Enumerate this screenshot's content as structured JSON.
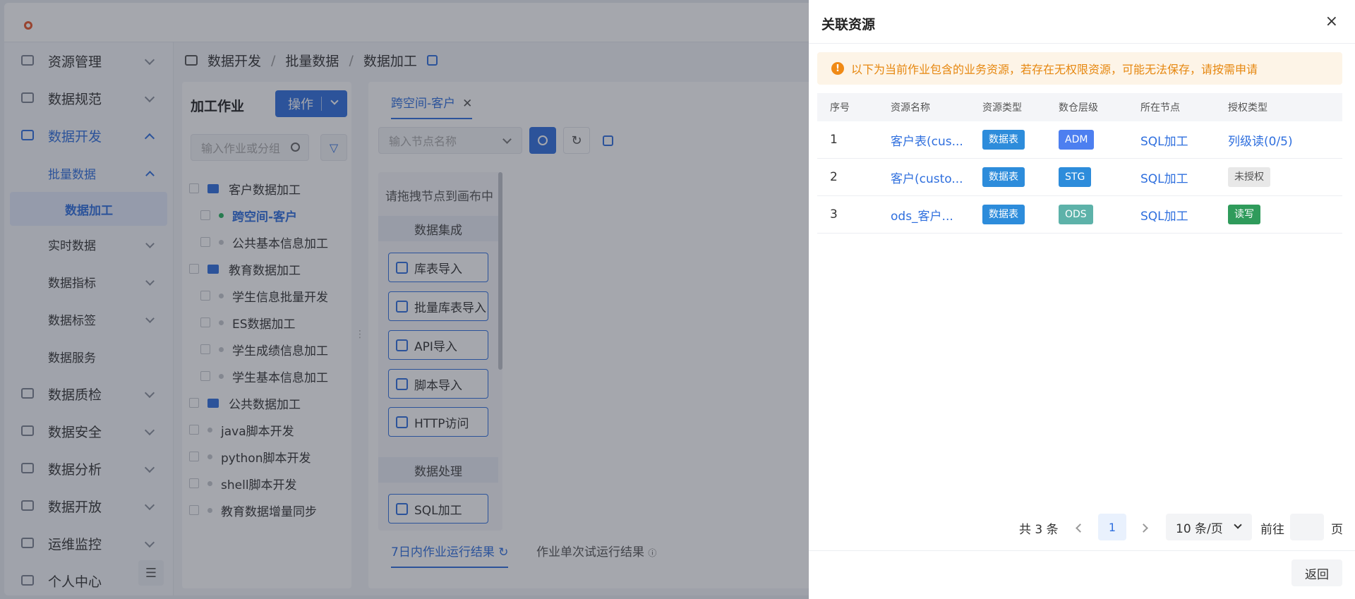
{
  "sidebar": {
    "items": [
      {
        "label": "资源管理"
      },
      {
        "label": "数据规范"
      },
      {
        "label": "数据开发"
      },
      {
        "label": "批量数据"
      },
      {
        "label": "数据加工"
      },
      {
        "label": "实时数据"
      },
      {
        "label": "数据指标"
      },
      {
        "label": "数据标签"
      },
      {
        "label": "数据服务"
      },
      {
        "label": "数据质检"
      },
      {
        "label": "数据安全"
      },
      {
        "label": "数据分析"
      },
      {
        "label": "数据开放"
      },
      {
        "label": "运维监控"
      },
      {
        "label": "个人中心"
      }
    ]
  },
  "breadcrumb": {
    "l1": "数据开发",
    "sep": "/",
    "l2": "批量数据",
    "l3": "数据加工"
  },
  "jobs": {
    "title": "加工作业",
    "op_label": "操作",
    "search_placeholder": "输入作业或分组",
    "tree": [
      "客户数据加工",
      "跨空间-客户",
      "公共基本信息加工",
      "教育数据加工",
      "学生信息批量开发",
      "ES数据加工",
      "学生成绩信息加工",
      "学生基本信息加工",
      "公共数据加工",
      "java脚本开发",
      "python脚本开发",
      "shell脚本开发",
      "教育数据增量同步"
    ]
  },
  "editor": {
    "tab": "跨空间-客户",
    "node_placeholder": "输入节点名称",
    "hint": "请拖拽节点到画布中",
    "sec1": "数据集成",
    "nodes1": [
      "库表导入",
      "批量库表导入",
      "API导入",
      "脚本导入",
      "HTTP访问"
    ],
    "sec2": "数据处理",
    "nodes2": [
      "SQL加工"
    ],
    "bottom_tab1": "7日内作业运行结果",
    "bottom_tab2": "作业单次试运行结果"
  },
  "drawer": {
    "title": "关联资源",
    "close": "×",
    "alert": "以下为当前作业包含的业务资源，若存在无权限资源，可能无法保存，请按需申请",
    "alert_icon": "!",
    "columns": [
      "序号",
      "资源名称",
      "资源类型",
      "数仓层级",
      "所在节点",
      "授权类型"
    ],
    "rows": [
      {
        "no": "1",
        "name": "客户表(cus...",
        "type": "数据表",
        "layer": "ADM",
        "node": "SQL加工",
        "auth": "列级读(0/5)"
      },
      {
        "no": "2",
        "name": "客户(custo...",
        "type": "数据表",
        "layer": "STG",
        "node": "SQL加工",
        "auth": "未授权"
      },
      {
        "no": "3",
        "name": "ods_客户...",
        "type": "数据表",
        "layer": "ODS",
        "node": "SQL加工",
        "auth": "读写"
      }
    ],
    "pager": {
      "total": "共 3 条",
      "page": "1",
      "size": "10 条/页",
      "goto": "前往",
      "unit": "页",
      "goto_value": ""
    },
    "back": "返回"
  },
  "colors": {
    "accent": "#2f6fde",
    "warning": "#f08a16",
    "success": "#2f9b5b"
  }
}
